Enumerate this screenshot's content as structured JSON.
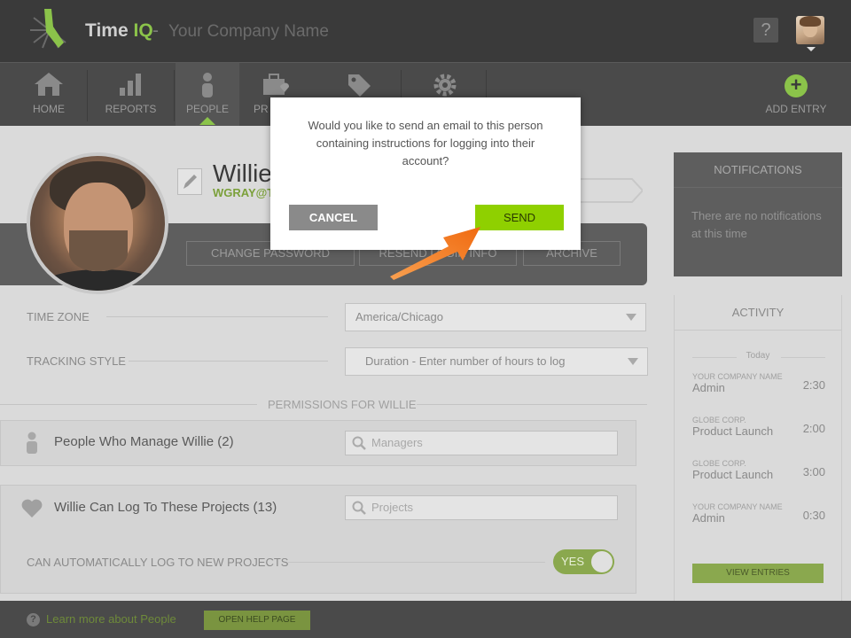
{
  "header": {
    "brand_main": "Time",
    "brand_accent": "IQ",
    "separator": "-",
    "company": "Your Company Name",
    "help": "?"
  },
  "nav": {
    "home": "HOME",
    "reports": "REPORTS",
    "people": "PEOPLE",
    "projects_partial": "PR",
    "add_entry": "ADD ENTRY",
    "add_symbol": "+"
  },
  "profile": {
    "name": "Willie",
    "email": "WGRAY@T",
    "buttons": {
      "change_password": "CHANGE PASSWORD",
      "resend_login": "RESEND LOGIN INFO",
      "archive": "ARCHIVE"
    }
  },
  "settings": {
    "time_zone_label": "TIME ZONE",
    "time_zone_value": "America/Chicago",
    "tracking_label": "TRACKING STYLE",
    "tracking_value": "Duration - Enter number of hours to log"
  },
  "permissions": {
    "title": "PERMISSIONS FOR WILLIE",
    "managers_label": "People Who Manage Willie (2)",
    "managers_placeholder": "Managers",
    "projects_label": "Willie Can Log To These Projects (13)",
    "projects_placeholder": "Projects",
    "auto_log_label": "CAN AUTOMATICALLY LOG TO NEW PROJECTS",
    "auto_log_value": "YES"
  },
  "notifications": {
    "title": "NOTIFICATIONS",
    "empty": "There are no notifications at this time"
  },
  "activity": {
    "title": "ACTIVITY",
    "today": "Today",
    "entries": [
      {
        "company": "YOUR COMPANY NAME",
        "project": "Admin",
        "hours": "2:30"
      },
      {
        "company": "GLOBE CORP.",
        "project": "Product Launch",
        "hours": "2:00"
      },
      {
        "company": "GLOBE CORP.",
        "project": "Product Launch",
        "hours": "3:00"
      },
      {
        "company": "YOUR COMPANY NAME",
        "project": "Admin",
        "hours": "0:30"
      }
    ],
    "view_entries": "VIEW ENTRIES"
  },
  "footer": {
    "help_symbol": "?",
    "learn_more": "Learn more about People",
    "open_help": "OPEN HELP PAGE"
  },
  "modal": {
    "message": "Would you like to send an email to this person containing instructions for logging into their account?",
    "cancel": "CANCEL",
    "send": "SEND"
  },
  "colors": {
    "accent": "#8fd000",
    "arrow": "#f47a20"
  }
}
